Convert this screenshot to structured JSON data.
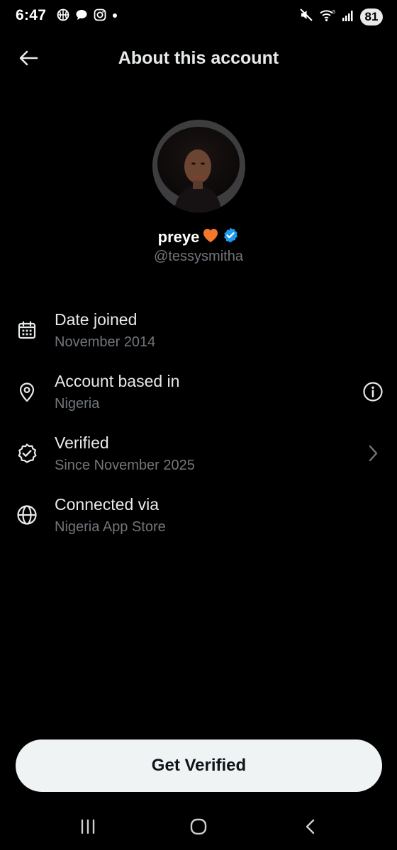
{
  "status_bar": {
    "time": "6:47",
    "left_icons": [
      "basketball-icon",
      "chat-bubble-icon",
      "instagram-icon",
      "dot-icon"
    ],
    "right_icons": [
      "mute-icon",
      "wifi-icon",
      "signal-icon"
    ],
    "battery": "81"
  },
  "header": {
    "title": "About this account",
    "back_icon": "arrow-left-icon"
  },
  "profile": {
    "display_name": "preye",
    "name_emoji": "🧡",
    "handle": "@tessysmitha",
    "verified_badge_color": "#1d9bf0"
  },
  "info": [
    {
      "icon": "calendar-icon",
      "label": "Date joined",
      "value": "November 2014"
    },
    {
      "icon": "location-pin-icon",
      "label": "Account based in",
      "value": "Nigeria",
      "trailing": "info-icon"
    },
    {
      "icon": "verified-check-icon",
      "label": "Verified",
      "value": "Since November 2025",
      "trailing": "chevron-right-icon"
    },
    {
      "icon": "globe-icon",
      "label": "Connected via",
      "value": "Nigeria App Store"
    }
  ],
  "cta": {
    "label": "Get Verified"
  },
  "nav": [
    "recents-icon",
    "home-icon",
    "back-icon"
  ],
  "colors": {
    "background": "#000000",
    "primary_text": "#e7e9ea",
    "secondary_text": "#71767b",
    "button_bg": "#eff3f4",
    "accent": "#1d9bf0"
  }
}
